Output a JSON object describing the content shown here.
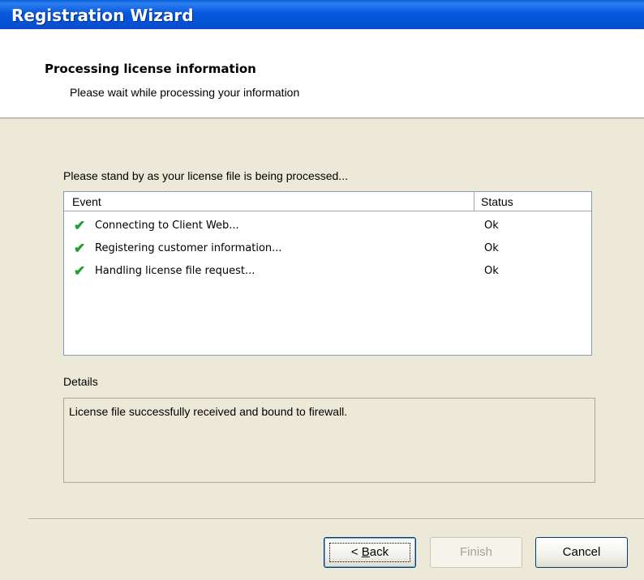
{
  "window": {
    "title": "Registration Wizard"
  },
  "header": {
    "title": "Processing license information",
    "subtitle": "Please wait while processing your information"
  },
  "main": {
    "standby_text": "Please stand by as your license file is being processed...",
    "columns": {
      "event": "Event",
      "status": "Status"
    },
    "rows": [
      {
        "event": "Connecting to Client Web...",
        "status": "Ok"
      },
      {
        "event": "Registering customer information...",
        "status": "Ok"
      },
      {
        "event": "Handling license file request...",
        "status": "Ok"
      }
    ],
    "details_label": "Details",
    "details_text": "License file successfully received and bound to firewall."
  },
  "buttons": {
    "back_prefix": "< ",
    "back_underlined": "B",
    "back_rest": "ack",
    "finish": "Finish",
    "cancel": "Cancel"
  },
  "icons": {
    "row_status": "checkmark-icon"
  },
  "colors": {
    "titlebar": "#0352d5",
    "check": "#1e9e2e",
    "background": "#ece9d8"
  }
}
